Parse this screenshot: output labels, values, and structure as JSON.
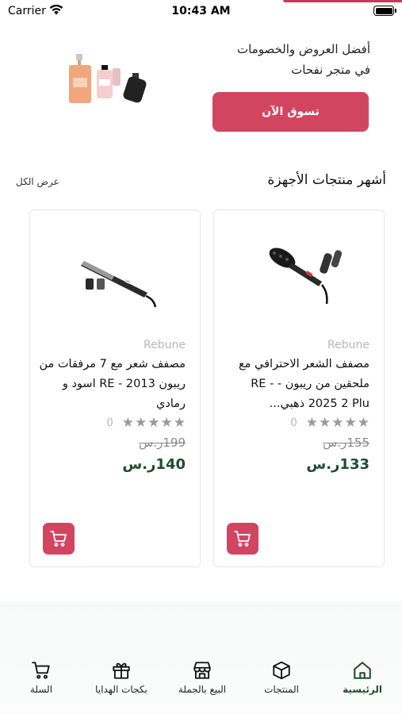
{
  "status_bar": {
    "carrier": "Carrier",
    "time": "10:43 AM"
  },
  "banner": {
    "line1": "أفضل العروض والخصومات",
    "line2": "في متجر نفحات",
    "button_label": "تسوق الآن"
  },
  "section": {
    "title": "أشهر  منتجات الأجهزة",
    "view_all": "عرض الكل"
  },
  "products": [
    {
      "brand": "Rebune",
      "name": "مصفف الشعر الاحترافي مع ملحقين من ريبون - RE - 2025 2 Plu ذهبي...",
      "rating_count": "0",
      "old_price": "155ر.س",
      "new_price": "133ر.س"
    },
    {
      "brand": "Rebune",
      "name": "مصفف شعر مع 7 مرفقات من ريبون 2013 - RE اسود و رمادي",
      "rating_count": "0",
      "old_price": "199ر.س",
      "new_price": "140ر.س"
    }
  ],
  "bottom_nav": {
    "items": [
      {
        "label": "الرئيسية",
        "icon": "home-icon",
        "active": true
      },
      {
        "label": "المنتجات",
        "icon": "box-icon",
        "active": false
      },
      {
        "label": "البيع بالجملة",
        "icon": "store-icon",
        "active": false
      },
      {
        "label": "بكجات الهدايا",
        "icon": "gift-icon",
        "active": false
      },
      {
        "label": "السلة",
        "icon": "cart-icon",
        "active": false
      }
    ]
  },
  "colors": {
    "accent": "#d24560",
    "price_green": "#1d4d2f",
    "star_gray": "#9a9a9a"
  }
}
